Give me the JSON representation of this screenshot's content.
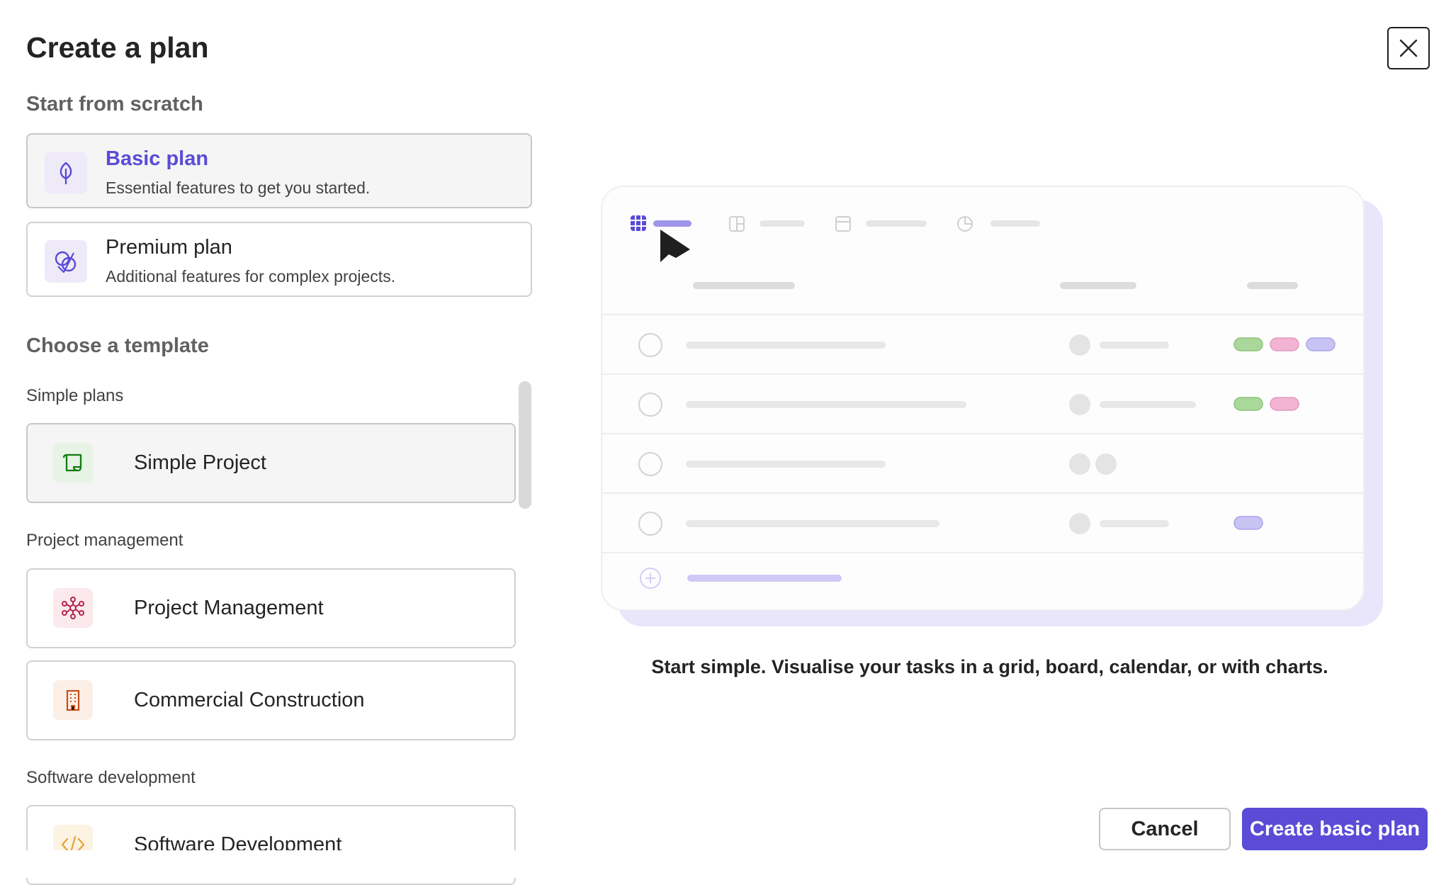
{
  "dialog": {
    "title": "Create a plan",
    "close_icon": "close-icon"
  },
  "scratch": {
    "heading": "Start from scratch",
    "plans": [
      {
        "name": "Basic plan",
        "description": "Essential features to get you started.",
        "icon": "leaf-icon",
        "selected": true
      },
      {
        "name": "Premium plan",
        "description": "Additional features for complex projects.",
        "icon": "premium-icon",
        "selected": false
      }
    ]
  },
  "templates": {
    "heading": "Choose a template",
    "groups": [
      {
        "label": "Simple plans",
        "items": [
          {
            "name": "Simple Project",
            "icon": "scroll-icon",
            "icon_color": "#107c10",
            "selected": true
          }
        ]
      },
      {
        "label": "Project management",
        "items": [
          {
            "name": "Project Management",
            "icon": "network-icon",
            "icon_color": "#b4234a"
          },
          {
            "name": "Commercial Construction",
            "icon": "building-icon",
            "icon_color": "#c4501a"
          }
        ]
      },
      {
        "label": "Software development",
        "items": [
          {
            "name": "Software Development",
            "icon": "code-icon",
            "icon_color": "#e8a33b"
          }
        ]
      }
    ]
  },
  "preview": {
    "caption": "Start simple. Visualise your tasks in a grid, board, calendar, or with charts.",
    "accent": "#5b4bd6",
    "tag_colors": {
      "green": "#a9d89a",
      "pink": "#f2b4d2",
      "lavender": "#c9c3f4"
    }
  },
  "footer": {
    "cancel_label": "Cancel",
    "create_label": "Create basic plan"
  }
}
